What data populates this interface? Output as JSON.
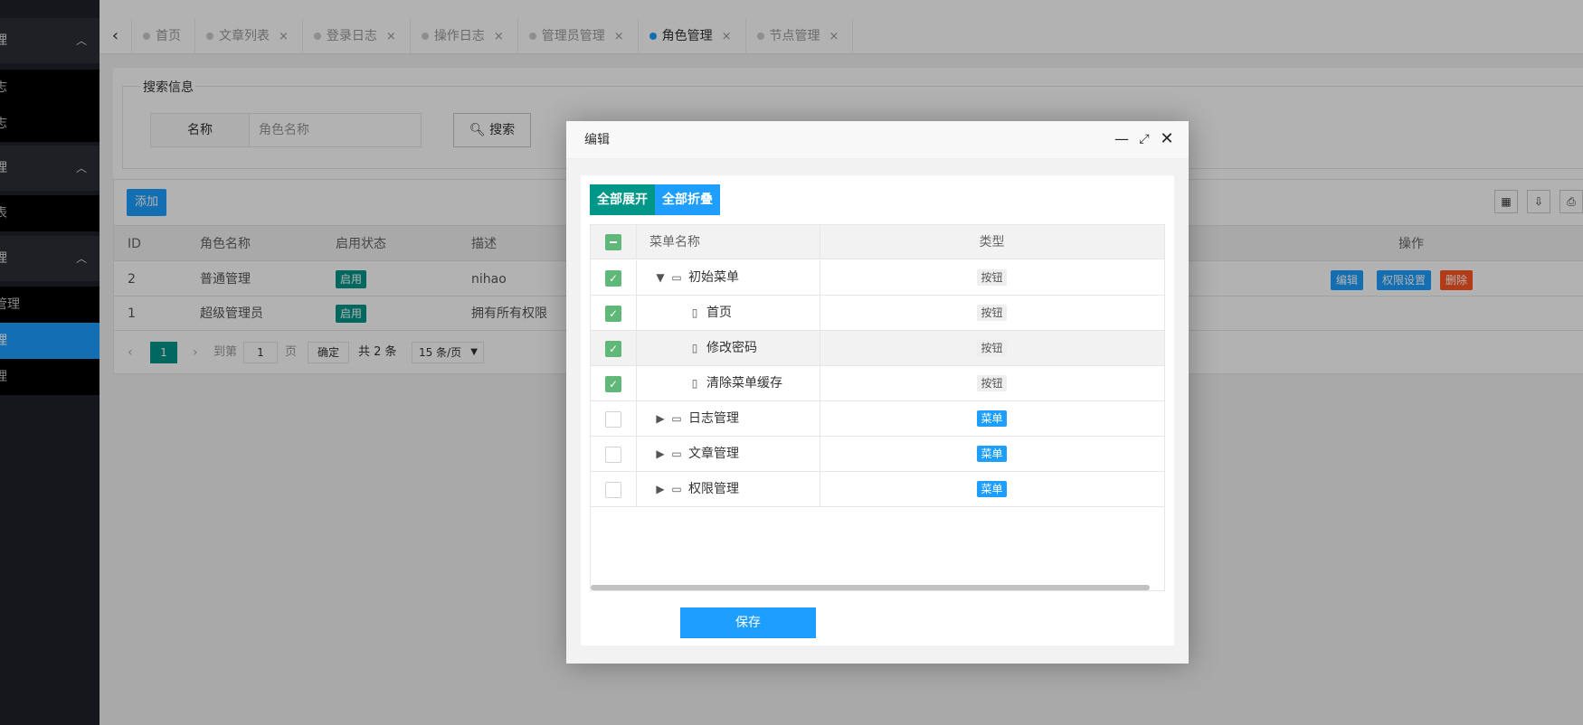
{
  "sidebar": {
    "groups": [
      {
        "label": "理",
        "arrow": "^"
      },
      {
        "label": "理",
        "arrow": "^"
      },
      {
        "label": "理",
        "arrow": "^"
      }
    ],
    "items": [
      {
        "label": "志"
      },
      {
        "label": "志"
      },
      {
        "label": "表"
      },
      {
        "label": "管理"
      },
      {
        "label": "理"
      },
      {
        "label": "理"
      }
    ]
  },
  "tabs": {
    "prev_icon": "‹",
    "items": [
      {
        "label": "首页",
        "closable": false
      },
      {
        "label": "文章列表",
        "closable": true
      },
      {
        "label": "登录日志",
        "closable": true
      },
      {
        "label": "操作日志",
        "closable": true
      },
      {
        "label": "管理员管理",
        "closable": true
      },
      {
        "label": "角色管理",
        "closable": true,
        "active": true
      },
      {
        "label": "节点管理",
        "closable": true
      }
    ],
    "close_glyph": "×"
  },
  "search": {
    "legend": "搜索信息",
    "name_label": "名称",
    "name_placeholder": "角色名称",
    "button_label": "搜索"
  },
  "table": {
    "add_label": "添加",
    "columns": [
      "ID",
      "角色名称",
      "启用状态",
      "描述",
      "操作"
    ],
    "rows": [
      {
        "id": "2",
        "name": "普通管理",
        "status": "启用",
        "desc": "nihao"
      },
      {
        "id": "1",
        "name": "超级管理员",
        "status": "启用",
        "desc": "拥有所有权限"
      }
    ],
    "ops": {
      "edit": "编辑",
      "perm": "权限设置",
      "delete": "删除"
    }
  },
  "pager": {
    "current": "1",
    "goto_label": "到第",
    "page_input": "1",
    "page_unit": "页",
    "confirm": "确定",
    "total": "共 2 条",
    "page_size": "15 条/页"
  },
  "modal": {
    "title": "编辑",
    "expand_all": "全部展开",
    "collapse_all": "全部折叠",
    "col_name": "菜单名称",
    "col_type": "类型",
    "rows": [
      {
        "name": "初始菜单",
        "type": "按钮",
        "checked": true,
        "level": 0,
        "expander": "down",
        "icon": "folder-icon"
      },
      {
        "name": "首页",
        "type": "按钮",
        "checked": true,
        "level": 1,
        "expander": "",
        "icon": "file-icon"
      },
      {
        "name": "修改密码",
        "type": "按钮",
        "checked": true,
        "level": 1,
        "expander": "",
        "icon": "file-icon"
      },
      {
        "name": "清除菜单缓存",
        "type": "按钮",
        "checked": true,
        "level": 1,
        "expander": "",
        "icon": "file-icon"
      },
      {
        "name": "日志管理",
        "type": "菜单",
        "checked": false,
        "level": 0,
        "expander": "right",
        "icon": "folder-icon"
      },
      {
        "name": "文章管理",
        "type": "菜单",
        "checked": false,
        "level": 0,
        "expander": "right",
        "icon": "folder-icon"
      },
      {
        "name": "权限管理",
        "type": "菜单",
        "checked": false,
        "level": 0,
        "expander": "right",
        "icon": "folder-icon"
      }
    ],
    "save_label": "保存"
  },
  "colors": {
    "primary": "#1e9fff",
    "green": "#009688",
    "danger": "#ff5722",
    "checkbox": "#5fb878",
    "sidebar": "#20222a"
  }
}
